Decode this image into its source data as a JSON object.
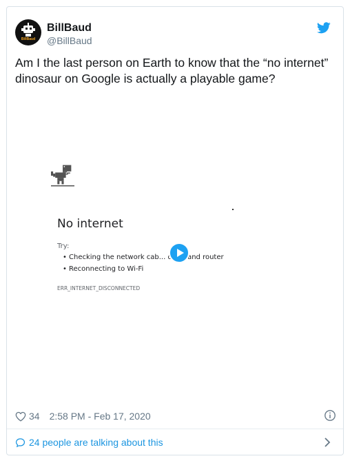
{
  "user": {
    "name": "BillBaud",
    "handle": "@BillBaud",
    "avatar_text": "BillBaud"
  },
  "tweet": {
    "text": "Am I the last person on Earth to know that the “no internet” dinosaur on Google is actually a playable game?"
  },
  "media": {
    "title": "No internet",
    "try_label": "Try:",
    "suggestions": [
      "Checking the network cab... dem, and router",
      "Reconnecting to Wi-Fi"
    ],
    "error_code": "ERR_INTERNET_DISCONNECTED"
  },
  "footer": {
    "likes": "34",
    "timestamp": "2:58 PM - Feb 17, 2020",
    "talking": "24 people are talking about this"
  },
  "colors": {
    "accent": "#1da1f2",
    "link": "#1b95e0",
    "muted": "#657786"
  },
  "icons": [
    "twitter-bird-icon",
    "play-icon",
    "heart-icon",
    "info-icon",
    "comment-bubble-icon",
    "chevron-right-icon",
    "dino-icon"
  ]
}
